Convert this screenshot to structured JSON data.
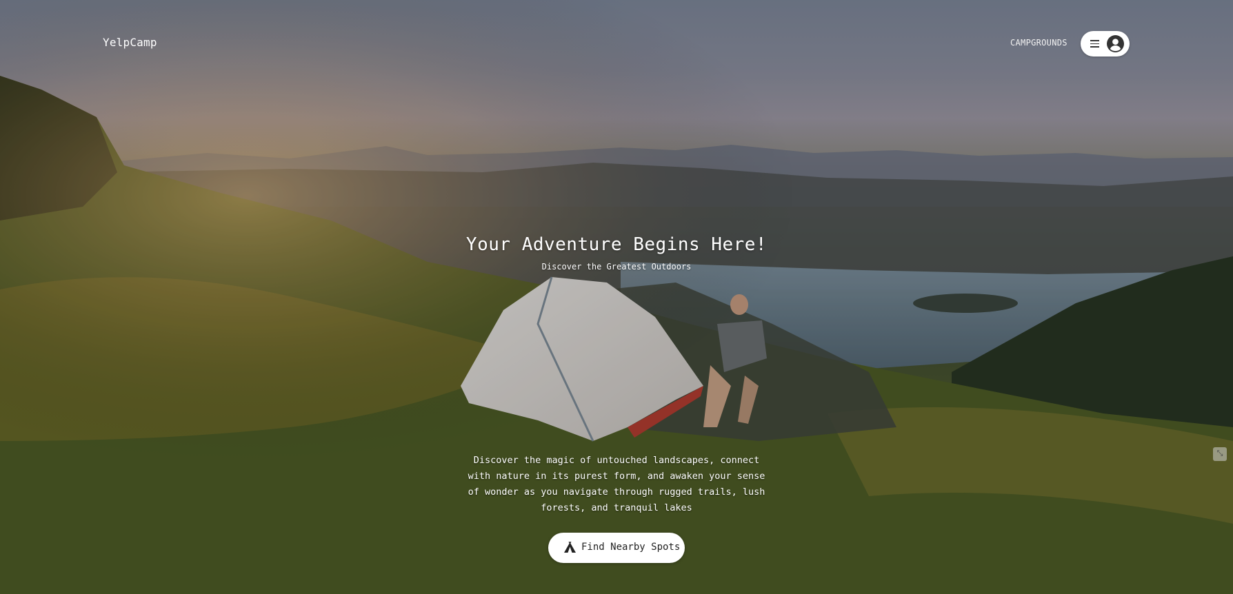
{
  "nav": {
    "brand": "YelpCamp",
    "campgrounds_link": "CAMPGROUNDS",
    "menu_icon": "hamburger-icon",
    "user_icon": "user-avatar-icon"
  },
  "hero": {
    "headline": "Your Adventure Begins Here!",
    "subheadline": "Discover the Greatest Outdoors",
    "description": "Discover the magic of untouched landscapes, connect with nature in its purest form, and awaken your sense of wonder as you navigate through rugged trails, lush forests, and tranquil lakes",
    "cta_label": "Find Nearby Spots",
    "cta_icon": "tent-icon",
    "background": "mountain campsite at sunset with tent and lake"
  },
  "side_chip": {
    "label": "⤡"
  },
  "colors": {
    "text": "#ffffff",
    "button_bg": "#ffffff",
    "button_text": "#222222"
  }
}
